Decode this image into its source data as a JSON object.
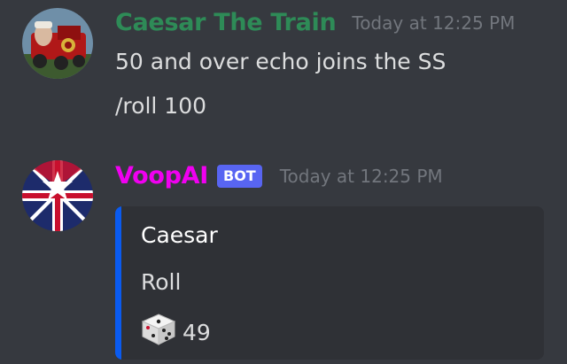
{
  "colors": {
    "background": "#36393f",
    "caesar_name": "#2e8b57",
    "voopai_name": "#f000f0",
    "bot_tag": "#5865f2",
    "embed_background": "#2f3136",
    "embed_accent": "#0a5bf0",
    "timestamp": "#72767d",
    "text": "#dcddde"
  },
  "messages": [
    {
      "author": "Caesar The Train",
      "timestamp": "Today at 12:25 PM",
      "avatar_icon": "train-avatar-icon",
      "lines": [
        "50 and over echo joins the SS",
        "/roll 100"
      ]
    },
    {
      "author": "VoopAI",
      "badge": "BOT",
      "timestamp": "Today at 12:25 PM",
      "avatar_icon": "flag-avatar-icon",
      "embed": {
        "author": "Caesar",
        "title": "Roll",
        "result_icon": "dice-icon",
        "result": "49"
      }
    }
  ]
}
